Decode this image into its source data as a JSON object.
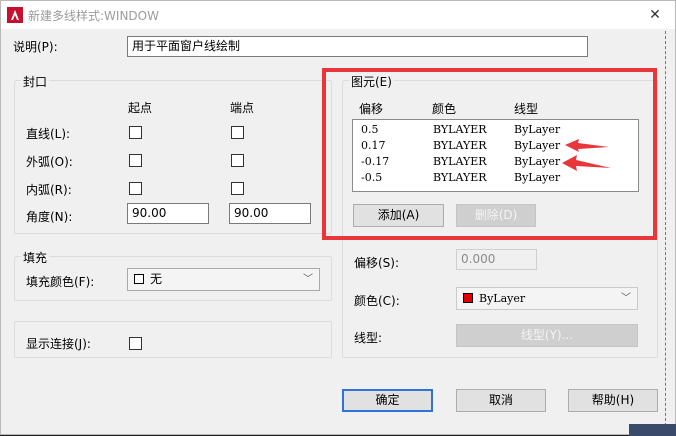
{
  "title": "新建多线样式:WINDOW",
  "description": {
    "label": "说明(P):",
    "value": "用于平面窗户线绘制"
  },
  "caps": {
    "group_title": "封口",
    "col_start": "起点",
    "col_end": "端点",
    "line_label": "直线(L):",
    "outer_arc_label": "外弧(O):",
    "inner_arc_label": "内弧(R):",
    "angle_label": "角度(N):",
    "angle_start": "90.00",
    "angle_end": "90.00"
  },
  "fill": {
    "group_title": "填充",
    "color_label": "填充颜色(F):",
    "color_value": "无"
  },
  "display_joints": {
    "label": "显示连接(J):"
  },
  "elements": {
    "group_title": "图元(E)",
    "headers": [
      "偏移",
      "颜色",
      "线型"
    ],
    "rows": [
      {
        "offset": "0.5",
        "color": "BYLAYER",
        "linetype": "ByLayer"
      },
      {
        "offset": "0.17",
        "color": "BYLAYER",
        "linetype": "ByLayer"
      },
      {
        "offset": "-0.17",
        "color": "BYLAYER",
        "linetype": "ByLayer"
      },
      {
        "offset": "-0.5",
        "color": "BYLAYER",
        "linetype": "ByLayer"
      }
    ],
    "add_button": "添加(A)",
    "delete_button": "删除(D)"
  },
  "properties": {
    "offset_label": "偏移(S):",
    "offset_value": "0.000",
    "color_label": "颜色(C):",
    "color_value": "ByLayer",
    "linetype_label": "线型:",
    "linetype_button": "线型(Y)..."
  },
  "buttons": {
    "ok": "确定",
    "cancel": "取消",
    "help": "帮助(H)"
  },
  "colors": {
    "highlight_frame": "#e8363a",
    "arrow": "#e8363a",
    "default_button_border": "#2f73d8"
  }
}
